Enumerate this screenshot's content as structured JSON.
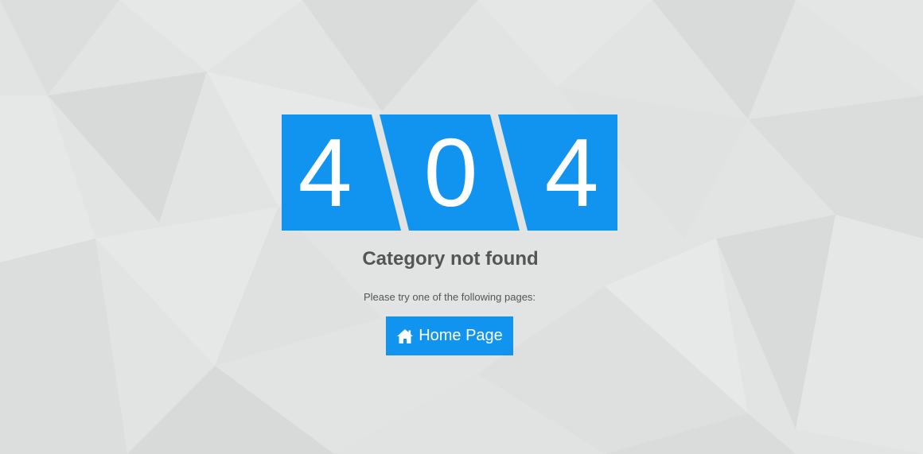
{
  "error_code": {
    "digit_1": "4",
    "digit_2": "0",
    "digit_3": "4"
  },
  "title": "Category not found",
  "subtitle": "Please try one of the following pages:",
  "home_button": {
    "label": "Home Page",
    "icon": "home-icon"
  },
  "colors": {
    "accent": "#1194f0",
    "background": "#e2e3e3",
    "text": "#555555"
  }
}
